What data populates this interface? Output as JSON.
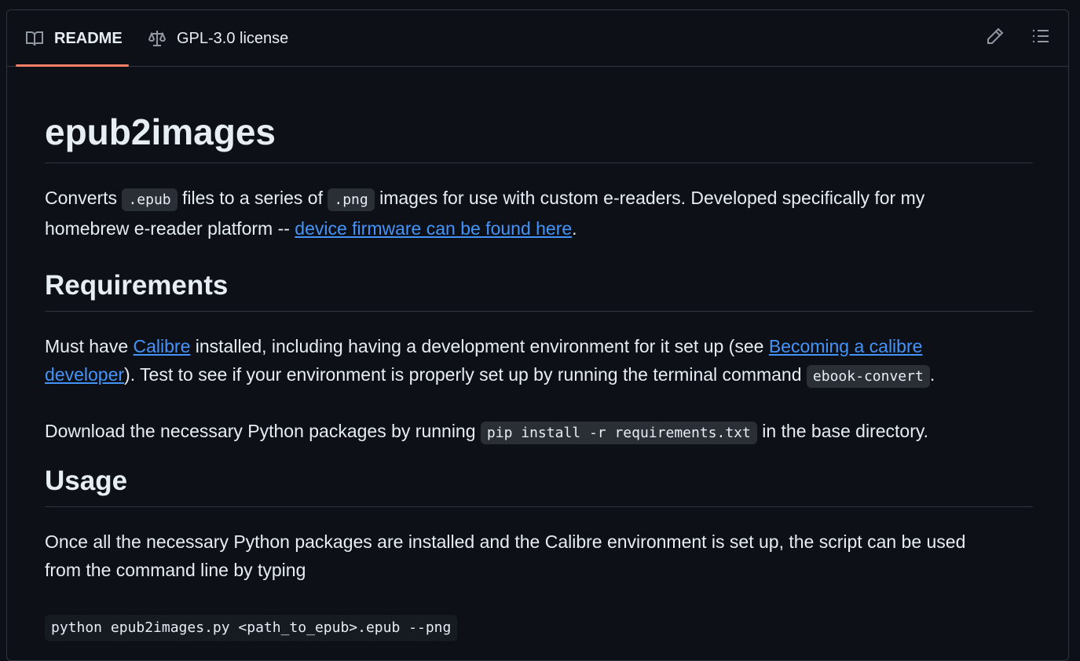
{
  "tabs": {
    "readme_label": "README",
    "license_label": "GPL-3.0 license"
  },
  "icons": {
    "readme": "book-icon",
    "license": "law-scale-icon",
    "edit": "pencil-icon",
    "toc": "list-unordered-icon"
  },
  "colors": {
    "accent_tab": "#f78166",
    "link": "#4493f8",
    "background": "#0d1117",
    "border": "#30363d"
  },
  "readme": {
    "title": "epub2images",
    "intro": {
      "t1": "Converts ",
      "code1": ".epub",
      "t2": " files to a series of ",
      "code2": ".png",
      "t3": " images for use with custom e-readers. Developed specifically for my homebrew e-reader platform -- ",
      "link": "device firmware can be found here",
      "t4": "."
    },
    "requirements": {
      "heading": "Requirements",
      "p1": {
        "t1": "Must have ",
        "link1": "Calibre",
        "t2": " installed, including having a development environment for it set up (see ",
        "link2": "Becoming a calibre developer",
        "t3": "). Test to see if your environment is properly set up by running the terminal command ",
        "code": "ebook-convert",
        "t4": "."
      },
      "p2": {
        "t1": "Download the necessary Python packages by running ",
        "code": "pip install -r requirements.txt",
        "t2": " in the base directory."
      }
    },
    "usage": {
      "heading": "Usage",
      "p1": "Once all the necessary Python packages are installed and the Calibre environment is set up, the script can be used from the command line by typing",
      "command": "python epub2images.py <path_to_epub>.epub --png"
    }
  }
}
